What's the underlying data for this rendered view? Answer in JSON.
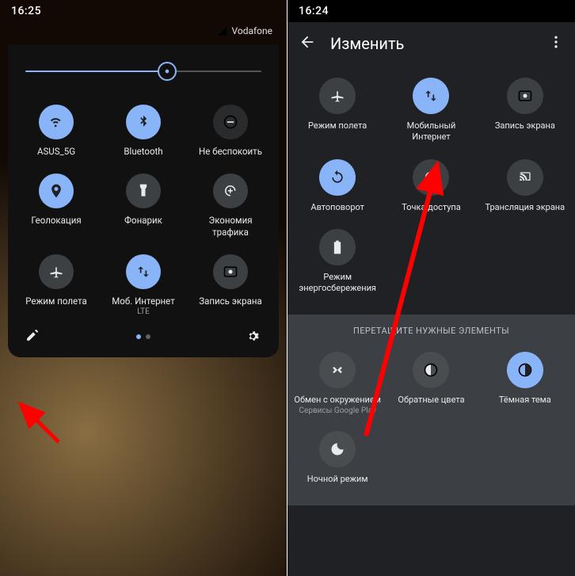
{
  "left": {
    "time": "16:25",
    "carrier": "Vodafone",
    "brightness_percent": 60,
    "tiles": [
      {
        "id": "wifi",
        "label": "ASUS_5G",
        "state": "active"
      },
      {
        "id": "bluetooth",
        "label": "Bluetooth",
        "state": "active"
      },
      {
        "id": "dnd",
        "label": "Не беспокоить",
        "state": "off"
      },
      {
        "id": "location",
        "label": "Геолокация",
        "state": "active"
      },
      {
        "id": "flashlight",
        "label": "Фонарик",
        "state": "inactive"
      },
      {
        "id": "datasaver",
        "label": "Экономия трафика",
        "state": "inactive"
      },
      {
        "id": "airplane",
        "label": "Режим полета",
        "state": "inactive"
      },
      {
        "id": "mobiledata",
        "label": "Моб. Интернет",
        "sub": "LTE",
        "state": "active"
      },
      {
        "id": "screenrec",
        "label": "Запись экрана",
        "state": "inactive"
      }
    ],
    "page_index": 0,
    "page_count": 2
  },
  "right": {
    "time": "16:24",
    "title": "Изменить",
    "tiles_active": [
      {
        "id": "airplane",
        "label": "Режим полета",
        "state": "inactive"
      },
      {
        "id": "mobiledata",
        "label": "Мобильный Интернет",
        "state": "active"
      },
      {
        "id": "screenrec",
        "label": "Запись экрана",
        "state": "inactive"
      },
      {
        "id": "rotate",
        "label": "Автоповорот",
        "state": "active"
      },
      {
        "id": "hotspot",
        "label": "Точка доступа",
        "state": "inactive"
      },
      {
        "id": "cast",
        "label": "Трансляция экрана",
        "state": "inactive"
      },
      {
        "id": "battery",
        "label": "Режим энергосбережения",
        "state": "inactive"
      }
    ],
    "drag_hint": "ПЕРЕТАЩИТЕ НУЖНЫЕ ЭЛЕМЕНТЫ",
    "tiles_available": [
      {
        "id": "nearby",
        "label": "Обмен с окружением",
        "sub": "Сервисы Google Play",
        "state": "off"
      },
      {
        "id": "invert",
        "label": "Обратные цвета",
        "state": "off"
      },
      {
        "id": "darktheme",
        "label": "Тёмная тема",
        "state": "active"
      },
      {
        "id": "night",
        "label": "Ночной режим",
        "state": "off"
      }
    ]
  },
  "icons": {
    "wifi": "wifi-icon",
    "bluetooth": "bluetooth-icon",
    "dnd": "dnd-icon",
    "location": "location-icon",
    "flashlight": "flashlight-icon",
    "datasaver": "datasaver-icon",
    "airplane": "airplane-icon",
    "mobiledata": "mobiledata-icon",
    "screenrec": "screenrec-icon",
    "rotate": "rotate-icon",
    "hotspot": "hotspot-icon",
    "cast": "cast-icon",
    "battery": "battery-icon",
    "nearby": "nearby-icon",
    "invert": "invert-icon",
    "darktheme": "darktheme-icon",
    "night": "night-icon"
  }
}
